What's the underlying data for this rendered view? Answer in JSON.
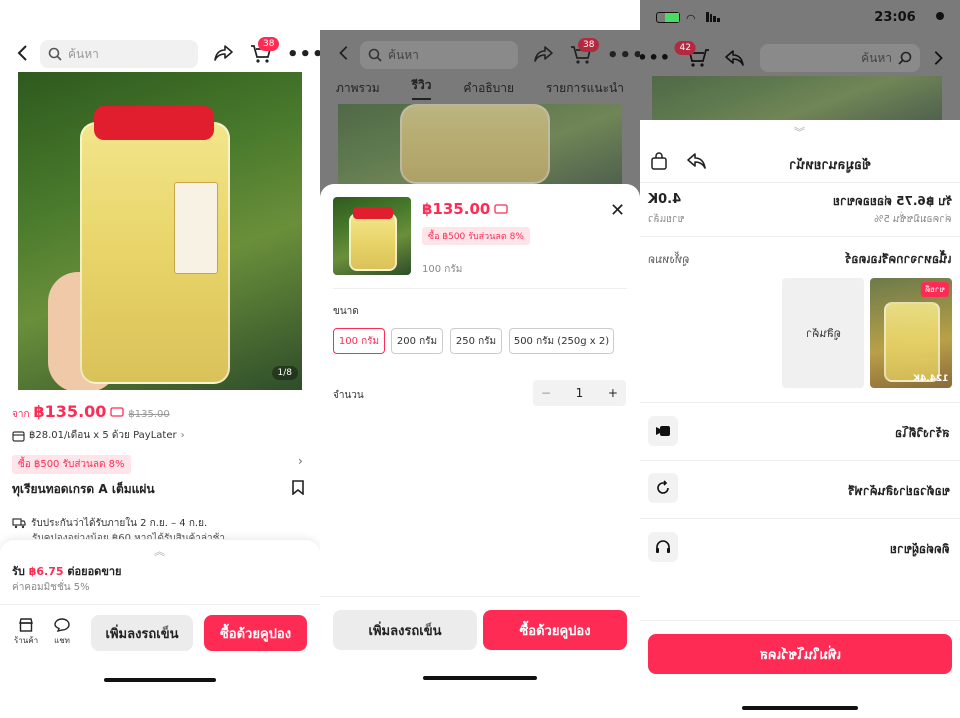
{
  "common": {
    "search_placeholder": "ค้นหา",
    "cart_count": "38",
    "accent": "#fe2c55"
  },
  "p1": {
    "image_counter": "1/8",
    "price_from": "จาก",
    "price": "฿135.00",
    "price_original": "฿135.00",
    "paylater": "฿28.01/เดือน x 5 ด้วย PayLater",
    "promo": "ซื้อ ฿500 รับส่วนลด 8%",
    "title": "ทุเรียนทอดเกรด A เต็มแผ่น",
    "shipping": "รับประกันว่าได้รับภายใน 2 ก.ย. – 4 ก.ย.",
    "shipping2": "รับคูปองอย่างน้อย ฿60 หากได้รับสินค้าล่าช้า",
    "commission_prefix": "รับ",
    "commission_amount": "฿6.75",
    "commission_suffix": "ต่อยอดขาย",
    "commission_rate": "ค่าคอมมิชชั่น 5%",
    "shop_label": "ร้านค้า",
    "chat_label": "แชท",
    "add_cart": "เพิ่มลงรถเข็น",
    "buy_coupon": "ซื้อด้วยคูปอง"
  },
  "p2": {
    "tabs": [
      "ภาพรวม",
      "รีวิว",
      "คำอธิบาย",
      "รายการแนะนำ"
    ],
    "active_tab": "รีวิว",
    "price": "฿135.00",
    "promo": "ซื้อ ฿500 รับส่วนลด 8%",
    "variant": "100 กรัม",
    "size_label": "ขนาด",
    "sizes": [
      "100 กรัม",
      "200 กรัม",
      "250 กรัม",
      "500 กรัม (250g x 2)"
    ],
    "qty_label": "จำนวน",
    "qty": "1",
    "add_cart": "เพิ่มลงรถเข็น",
    "buy_coupon": "ซื้อด้วยคูปอง"
  },
  "p3": {
    "status_time": "23:06",
    "search_placeholder": "ค้นหา",
    "cart_count": "42",
    "header_title": "ข้อมูลนายหน้า",
    "commission_line": "รับ ฿6.75 ต่อยอดขาย",
    "commission_rate_line": "ค่าคอมมิชชั่น 5%",
    "sold_count": "4.0K",
    "sold_label": "ขายแล้ว",
    "creator_content": "เนื้อหาจากครีเอเตอร์",
    "view_all": "ดูทั้งหมด",
    "video_views": "124.4K",
    "video_tag": "ขายดี",
    "view_product": "ดูสินค้า",
    "menu": [
      "สร้างวิดีโอ",
      "ขอตัวอย่างสินค้าฟรี",
      "ติดต่อผู้ขาย"
    ],
    "add_showcase": "เพิ่มในโชว์เคส"
  }
}
